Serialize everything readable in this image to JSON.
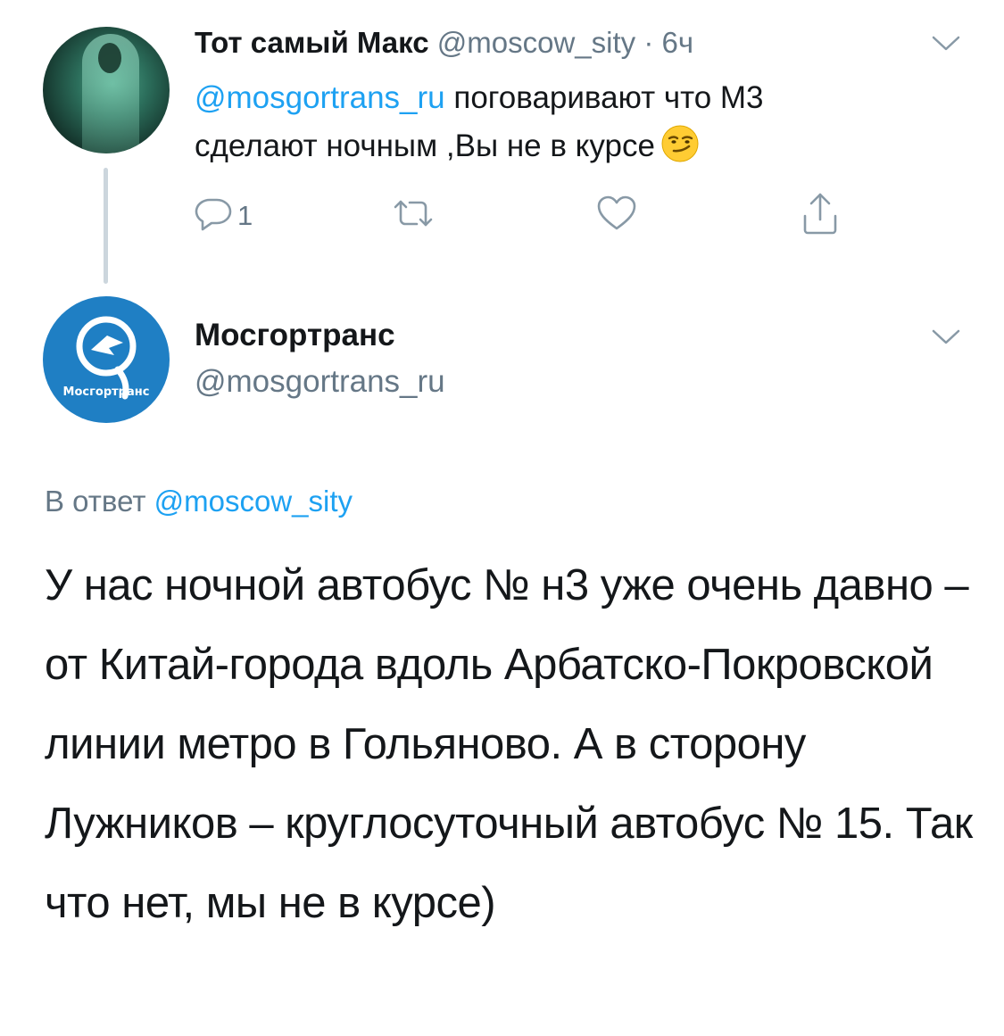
{
  "tweet1": {
    "author_name": "Тот самый Макс",
    "author_handle": "@moscow_sity",
    "separator": "·",
    "time": "6ч",
    "mention": "@mosgortrans_ru",
    "text": " поговаривают что М3 сделают ночным ,Вы не в курсе",
    "emoji": "smirking-face",
    "reply_count": "1"
  },
  "tweet2": {
    "author_name": "Мосгортранс",
    "author_handle": "@mosgortrans_ru",
    "avatar_label": "Мосгортранс",
    "replying_prefix": "В ответ",
    "replying_to": "@moscow_sity",
    "text": "У нас ночной автобус № н3 уже очень давно – от Китай-города вдоль Арбатско-Покровской линии метро в Гольяново. А в сторону Лужников – круглосуточный автобус № 15. Так что нет, мы не в курсе)"
  },
  "icons": {
    "reply": "reply-icon",
    "retweet": "retweet-icon",
    "like": "heart-icon",
    "share": "share-icon",
    "menu": "chevron-down-icon"
  },
  "colors": {
    "link": "#1da1f2",
    "secondary": "#657786",
    "text": "#14171a",
    "brand_blue": "#1f7fc4",
    "thread_line": "#ccd6dd"
  }
}
